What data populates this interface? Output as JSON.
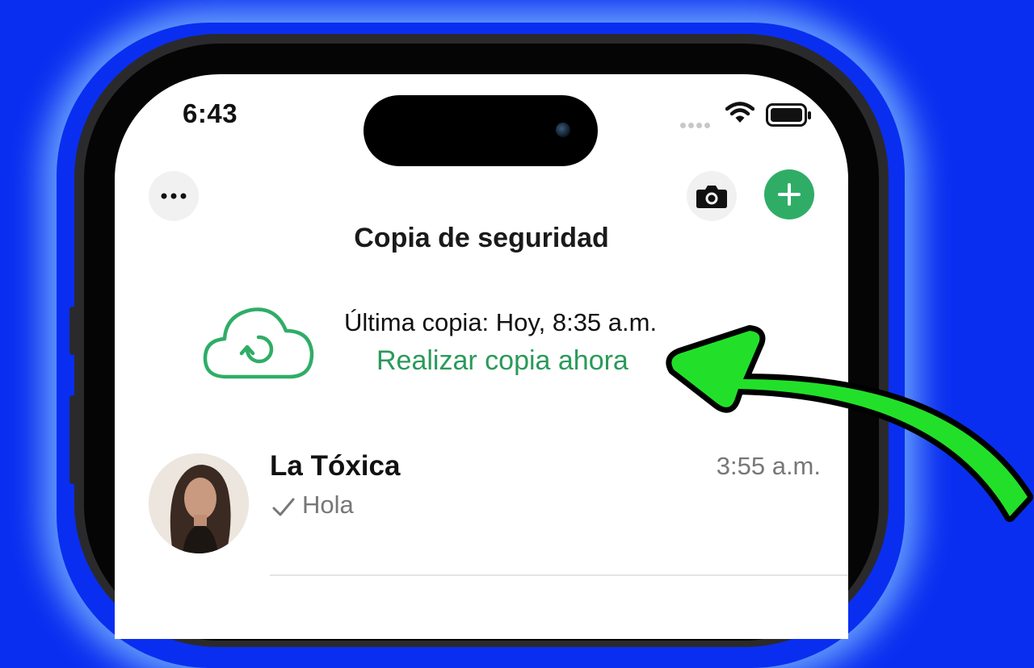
{
  "status_bar": {
    "time": "6:43"
  },
  "header": {
    "title": "Copia de seguridad"
  },
  "backup": {
    "last_backup": "Última copia: Hoy, 8:35 a.m.",
    "action": "Realizar copia ahora"
  },
  "chats": [
    {
      "name": "La Tóxica",
      "time": "3:55 a.m.",
      "last_message": "Hola"
    }
  ],
  "colors": {
    "background": "#0a2ef0",
    "accent_green": "#2fad67",
    "arrow_green": "#22e02a"
  },
  "icons": {
    "more": "ellipsis-icon",
    "camera": "camera-icon",
    "new_chat": "plus-icon",
    "backup": "cloud-sync-icon",
    "sent": "check-icon"
  }
}
